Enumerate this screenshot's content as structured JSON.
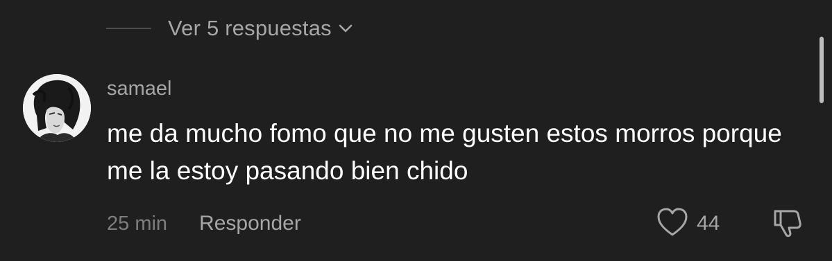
{
  "replies": {
    "label": "Ver 5 respuestas",
    "chevron_icon": "chevron-down-icon"
  },
  "comment": {
    "avatar_icon": "user-avatar",
    "username": "samael",
    "text": "me da mucho fomo que no me gusten estos morros porque me la estoy pasando bien chido",
    "timestamp": "25 min",
    "reply_label": "Responder",
    "like_icon": "heart-icon",
    "like_count": "44",
    "dislike_icon": "thumbs-down-icon"
  },
  "colors": {
    "background": "#1f1f1f",
    "primary_text": "#ffffff",
    "secondary_text": "#a6a6a6",
    "muted_text": "#7e7e7e"
  }
}
